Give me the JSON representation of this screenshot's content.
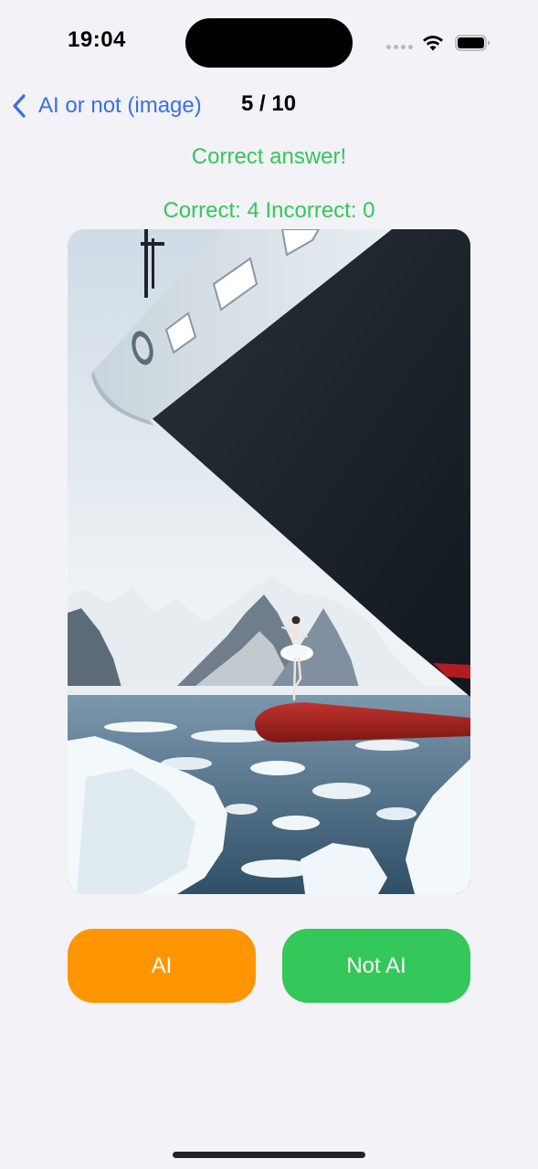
{
  "status_bar": {
    "time": "19:04"
  },
  "nav": {
    "back_label": "AI or not (image)",
    "progress": "5 / 10"
  },
  "feedback": {
    "result": "Correct answer!",
    "score": "Correct: 4 Incorrect: 0"
  },
  "image": {
    "subject": "ballerina-on-ship-bow-in-icy-sea"
  },
  "answers": {
    "ai_label": "AI",
    "not_ai_label": "Not AI"
  },
  "colors": {
    "accent_blue": "#3a6fe8",
    "success_green": "#34c759",
    "ai_orange": "#ff9500",
    "background": "#f2f2f7"
  }
}
